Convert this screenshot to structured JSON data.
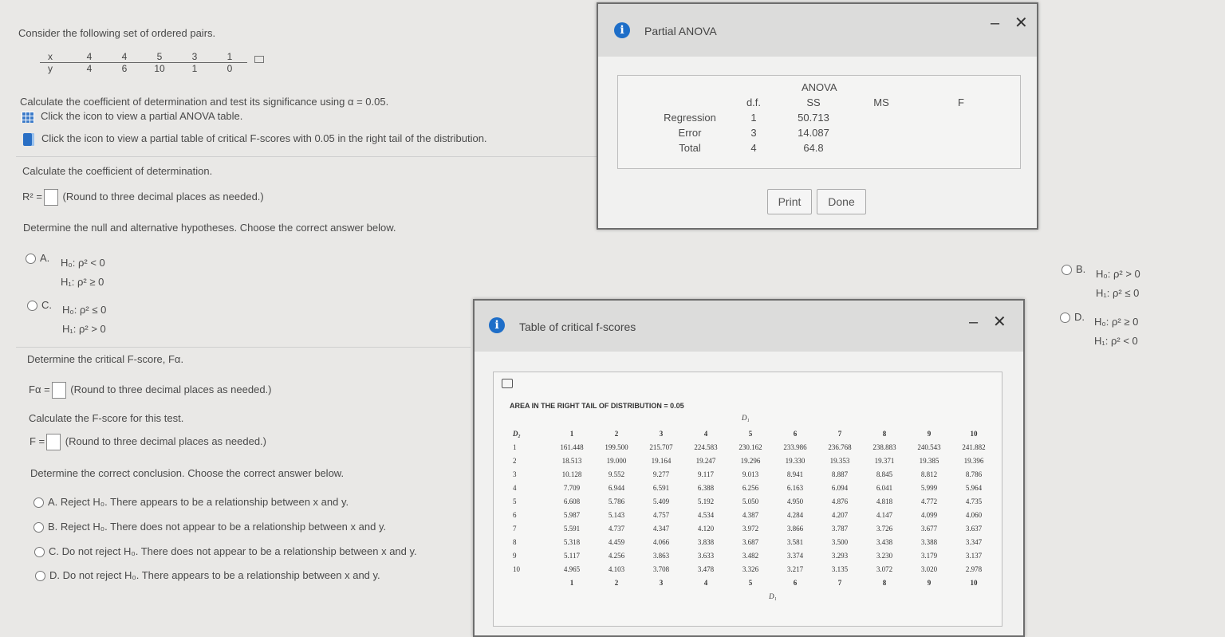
{
  "question": {
    "intro": "Consider the following set of ordered pairs.",
    "pairs": {
      "x_label": "x",
      "y_label": "y",
      "x": [
        "4",
        "4",
        "5",
        "3",
        "1"
      ],
      "y": [
        "4",
        "6",
        "10",
        "1",
        "0"
      ]
    },
    "task": "Calculate the coefficient of determination and test its significance using α = 0.05.",
    "link_anova": "Click the icon to view a partial ANOVA table.",
    "link_fscores": "Click the icon to view a partial table of critical F-scores with 0.05 in the right tail of the distribution.",
    "part1_prompt": "Calculate the coefficient of determination.",
    "r2_label": "R² =",
    "round_note": "(Round to three decimal places as needed.)",
    "hyp_prompt": "Determine the null and alternative hypotheses. Choose the correct answer below.",
    "hyp_options": [
      {
        "letter": "A.",
        "h0": "H₀: ρ² < 0",
        "h1": "H₁: ρ² ≥ 0"
      },
      {
        "letter": "B.",
        "h0": "H₀: ρ² > 0",
        "h1": "H₁: ρ² ≤ 0"
      },
      {
        "letter": "C.",
        "h0": "H₀: ρ² ≤ 0",
        "h1": "H₁: ρ² > 0"
      },
      {
        "letter": "D.",
        "h0": "H₀: ρ² ≥ 0",
        "h1": "H₁: ρ² < 0"
      }
    ],
    "fcrit_prompt": "Determine the critical F-score, Fα.",
    "fcrit_label": "Fα =",
    "fcalc_prompt": "Calculate the F-score for this test.",
    "f_label": "F =",
    "concl_prompt": "Determine the correct conclusion. Choose the correct answer below.",
    "concl_options": [
      {
        "letter": "A.",
        "text": "Reject H₀. There appears to be a relationship between x and y."
      },
      {
        "letter": "B.",
        "text": "Reject H₀. There does not appear to be a relationship between x and y."
      },
      {
        "letter": "C.",
        "text": "Do not reject H₀. There does not appear to be a relationship between x and y."
      },
      {
        "letter": "D.",
        "text": "Do not reject H₀. There appears to be a relationship between x and y."
      }
    ]
  },
  "anova_dialog": {
    "title": "Partial ANOVA",
    "table_title": "ANOVA",
    "headers": [
      "",
      "d.f.",
      "SS",
      "MS",
      "F"
    ],
    "rows": [
      [
        "Regression",
        "1",
        "50.713",
        "",
        ""
      ],
      [
        "Error",
        "3",
        "14.087",
        "",
        ""
      ],
      [
        "Total",
        "4",
        "64.8",
        "",
        ""
      ]
    ],
    "print_label": "Print",
    "done_label": "Done",
    "minimize": "–",
    "close": "✕"
  },
  "f_dialog": {
    "title": "Table of critical f-scores",
    "caption": "AREA IN THE RIGHT TAIL OF DISTRIBUTION = 0.05",
    "d1_label": "D₁",
    "d2_label": "D₂",
    "columns": [
      "1",
      "2",
      "3",
      "4",
      "5",
      "6",
      "7",
      "8",
      "9",
      "10"
    ],
    "rows": [
      {
        "d2": "1",
        "v": [
          "161.448",
          "199.500",
          "215.707",
          "224.583",
          "230.162",
          "233.986",
          "236.768",
          "238.883",
          "240.543",
          "241.882"
        ]
      },
      {
        "d2": "2",
        "v": [
          "18.513",
          "19.000",
          "19.164",
          "19.247",
          "19.296",
          "19.330",
          "19.353",
          "19.371",
          "19.385",
          "19.396"
        ]
      },
      {
        "d2": "3",
        "v": [
          "10.128",
          "9.552",
          "9.277",
          "9.117",
          "9.013",
          "8.941",
          "8.887",
          "8.845",
          "8.812",
          "8.786"
        ]
      },
      {
        "d2": "4",
        "v": [
          "7.709",
          "6.944",
          "6.591",
          "6.388",
          "6.256",
          "6.163",
          "6.094",
          "6.041",
          "5.999",
          "5.964"
        ]
      },
      {
        "d2": "5",
        "v": [
          "6.608",
          "5.786",
          "5.409",
          "5.192",
          "5.050",
          "4.950",
          "4.876",
          "4.818",
          "4.772",
          "4.735"
        ]
      },
      {
        "d2": "6",
        "v": [
          "5.987",
          "5.143",
          "4.757",
          "4.534",
          "4.387",
          "4.284",
          "4.207",
          "4.147",
          "4.099",
          "4.060"
        ]
      },
      {
        "d2": "7",
        "v": [
          "5.591",
          "4.737",
          "4.347",
          "4.120",
          "3.972",
          "3.866",
          "3.787",
          "3.726",
          "3.677",
          "3.637"
        ]
      },
      {
        "d2": "8",
        "v": [
          "5.318",
          "4.459",
          "4.066",
          "3.838",
          "3.687",
          "3.581",
          "3.500",
          "3.438",
          "3.388",
          "3.347"
        ]
      },
      {
        "d2": "9",
        "v": [
          "5.117",
          "4.256",
          "3.863",
          "3.633",
          "3.482",
          "3.374",
          "3.293",
          "3.230",
          "3.179",
          "3.137"
        ]
      },
      {
        "d2": "10",
        "v": [
          "4.965",
          "4.103",
          "3.708",
          "3.478",
          "3.326",
          "3.217",
          "3.135",
          "3.072",
          "3.020",
          "2.978"
        ]
      }
    ],
    "minimize": "–",
    "close": "✕"
  }
}
